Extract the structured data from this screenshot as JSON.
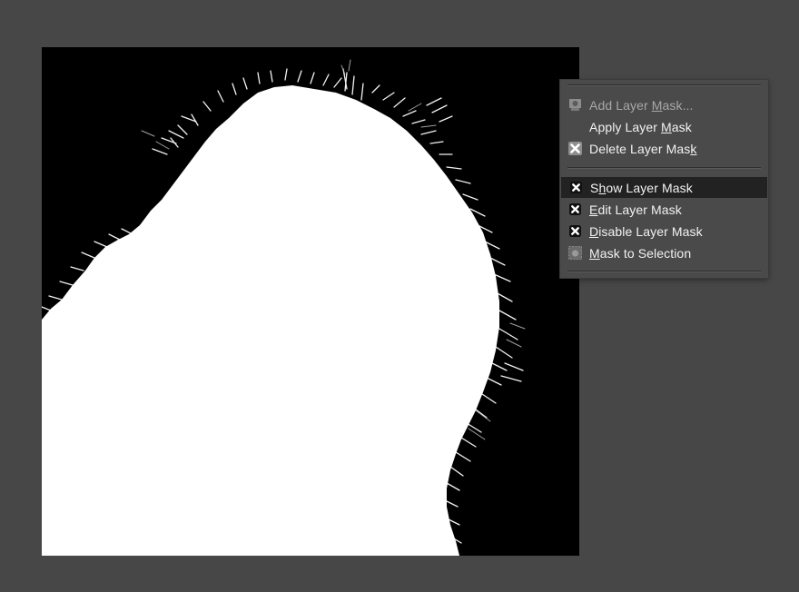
{
  "canvas": {
    "background": "#474747",
    "mask_background": "#000000",
    "mask_foreground": "#ffffff"
  },
  "context_menu": {
    "items": [
      {
        "before": "Add Layer ",
        "key": "M",
        "after": "ask...",
        "enabled": false,
        "icon": "add-mask-icon",
        "highlighted": false
      },
      {
        "before": "Apply Layer ",
        "key": "M",
        "after": "ask",
        "enabled": true,
        "icon": null,
        "highlighted": false
      },
      {
        "before": "Delete Layer Mas",
        "key": "k",
        "after": "",
        "enabled": true,
        "icon": "delete-mask-icon",
        "highlighted": false
      },
      {
        "before": "S",
        "key": "h",
        "after": "ow Layer Mask",
        "enabled": true,
        "icon": "checkbox-checked-icon",
        "highlighted": true
      },
      {
        "before": "",
        "key": "E",
        "after": "dit Layer Mask",
        "enabled": true,
        "icon": "checkbox-checked-icon",
        "highlighted": false
      },
      {
        "before": "",
        "key": "D",
        "after": "isable Layer Mask",
        "enabled": true,
        "icon": "checkbox-checked-icon",
        "highlighted": false
      },
      {
        "before": "",
        "key": "M",
        "after": "ask to Selection",
        "enabled": true,
        "icon": "mask-to-selection-icon",
        "highlighted": false
      }
    ]
  }
}
